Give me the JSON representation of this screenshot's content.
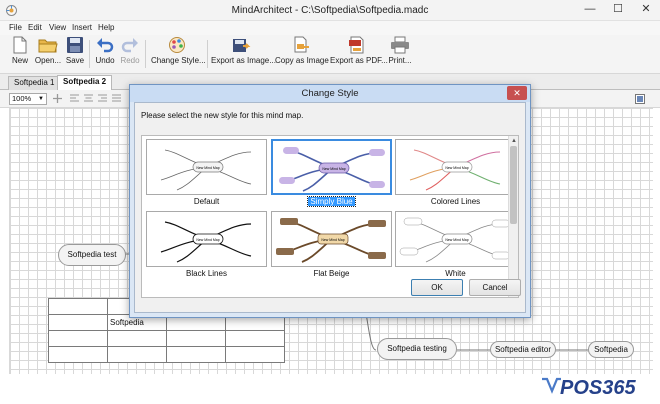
{
  "window": {
    "title": "MindArchitect - C:\\Softpedia\\Softpedia.madc",
    "minimize_glyph": "—",
    "maximize_glyph": "☐",
    "close_glyph": "✕"
  },
  "menu": [
    "File",
    "Edit",
    "View",
    "Insert",
    "Help"
  ],
  "toolbar": {
    "new": "New",
    "open": "Open...",
    "save": "Save",
    "undo": "Undo",
    "redo": "Redo",
    "change_style": "Change Style...",
    "export_image": "Export as Image...",
    "copy_image": "Copy as Image",
    "export_pdf": "Export as PDF...",
    "print": "Print..."
  },
  "tabs": [
    {
      "label": "Softpedia 1",
      "active": false
    },
    {
      "label": "Softpedia 2",
      "active": true
    }
  ],
  "format_bar": {
    "zoom": "100%"
  },
  "canvas": {
    "nodes": {
      "softpedia_test": "Softpedia test",
      "softpedia_testing": "Softpedia testing",
      "softpedia_editor": "Softpedia editor",
      "softpedia": "Softpedia"
    },
    "table_cell": "Softpedia"
  },
  "dialog": {
    "title": "Change Style",
    "close_glyph": "✕",
    "instruction": "Please select the new style for this mind map.",
    "thumb_center_text": "New Mind Map",
    "styles": [
      {
        "name": "Default",
        "selected": false
      },
      {
        "name": "Simply Blue",
        "selected": true
      },
      {
        "name": "Colored Lines",
        "selected": false
      },
      {
        "name": "Black Lines",
        "selected": false
      },
      {
        "name": "Flat Beige",
        "selected": false
      },
      {
        "name": "White",
        "selected": false
      }
    ],
    "ok": "OK",
    "cancel": "Cancel"
  },
  "watermark": {
    "text": "POS365"
  },
  "colors": {
    "accent_blue": "#3a8be0",
    "dialog_frame": "#c9dcf3",
    "close_red": "#c75050"
  }
}
